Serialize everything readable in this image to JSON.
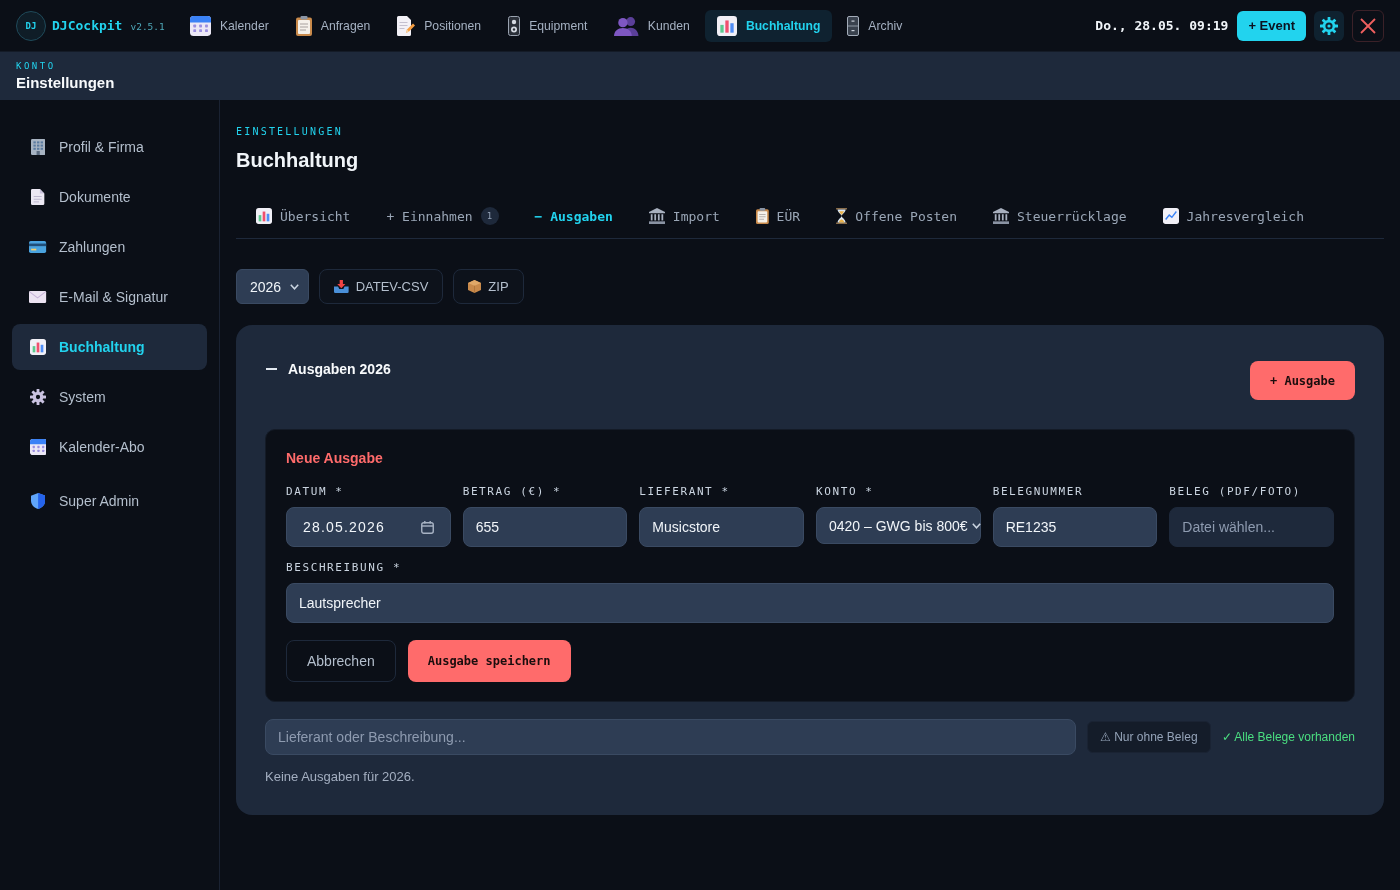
{
  "app": {
    "logo": "DJ",
    "name": "DJCockpit",
    "version": "v2.5.1"
  },
  "nav": [
    {
      "label": "Kalender",
      "selected": false
    },
    {
      "label": "Anfragen",
      "selected": false
    },
    {
      "label": "Positionen",
      "selected": false
    },
    {
      "label": "Equipment",
      "selected": false
    },
    {
      "label": "Kunden",
      "selected": false
    },
    {
      "label": "Buchhaltung",
      "selected": true
    },
    {
      "label": "Archiv",
      "selected": false
    }
  ],
  "top_actions": {
    "datetime": "Do., 28.05. 09:19",
    "event_button": "+ Event"
  },
  "page_header": {
    "eyebrow": "KONTO",
    "title": "Einstellungen"
  },
  "sidebar": {
    "items": [
      {
        "label": "Profil & Firma",
        "selected": false
      },
      {
        "label": "Dokumente",
        "selected": false
      },
      {
        "label": "Zahlungen",
        "selected": false
      },
      {
        "label": "E-Mail & Signatur",
        "selected": false
      },
      {
        "label": "Buchhaltung",
        "selected": true
      },
      {
        "label": "System",
        "selected": false
      },
      {
        "label": "Kalender-Abo",
        "selected": false
      },
      {
        "label": "Super Admin",
        "selected": false
      }
    ]
  },
  "content": {
    "eyebrow": "EINSTELLUNGEN",
    "title": "Buchhaltung",
    "tabs": [
      {
        "label": "Übersicht",
        "selected": false
      },
      {
        "label": "+ Einnahmen",
        "badge": "1",
        "selected": false
      },
      {
        "label": "− Ausgaben",
        "selected": true
      },
      {
        "label": "Import",
        "selected": false
      },
      {
        "label": "EÜR",
        "selected": false
      },
      {
        "label": "Offene Posten",
        "selected": false
      },
      {
        "label": "Steuerrücklage",
        "selected": false
      },
      {
        "label": "Jahresvergleich",
        "selected": false
      }
    ],
    "toolbar": {
      "year": "2026",
      "buttons": [
        "DATEV-CSV",
        "ZIP"
      ]
    },
    "section": {
      "title": "Ausgaben 2026",
      "expanded": true,
      "add_button": "+ Ausgabe",
      "form": {
        "title": "Neue Ausgabe",
        "fields": [
          {
            "kind": "date",
            "label": "DATUM *",
            "value": "28.05.2026"
          },
          {
            "kind": "number",
            "label": "BETRAG (€) *",
            "value": "655"
          },
          {
            "kind": "text",
            "label": "LIEFERANT *",
            "value": "Musicstore"
          },
          {
            "kind": "select",
            "label": "KONTO *",
            "value": "0420 – GWG bis 800€"
          },
          {
            "kind": "text",
            "label": "BELEGNUMMER",
            "value": "RE1235"
          },
          {
            "kind": "file",
            "label": "BELEG (PDF/FOTO)",
            "placeholder": "Datei wählen..."
          }
        ],
        "description": {
          "label": "BESCHREIBUNG *",
          "value": "Lautsprecher"
        },
        "cancel_button": "Abbrechen",
        "save_button": "Ausgabe speichern"
      },
      "filter": {
        "search_placeholder": "Lieferant oder Beschreibung...",
        "toggle_button": "⚠ Nur ohne Beleg",
        "status": "✓ Alle Belege vorhanden"
      },
      "empty_text": "Keine Ausgaben für 2026."
    }
  }
}
